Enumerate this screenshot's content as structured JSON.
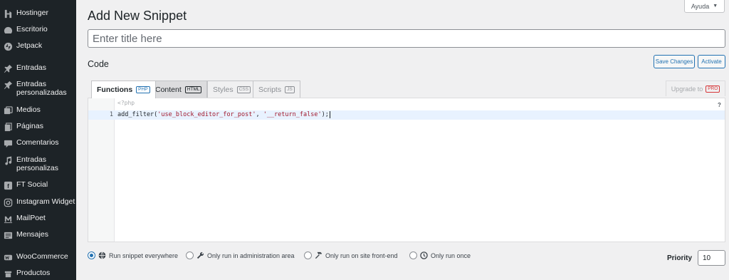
{
  "sidebar": {
    "items": [
      {
        "label": "Hostinger",
        "icon": "hostinger-icon"
      },
      {
        "label": "Escritorio",
        "icon": "dashboard-icon"
      },
      {
        "label": "Jetpack",
        "icon": "jetpack-icon"
      },
      {
        "label": "Entradas",
        "icon": "pin-icon"
      },
      {
        "label": "Entradas personalizadas",
        "icon": "pin-icon"
      },
      {
        "label": "Medios",
        "icon": "media-icon"
      },
      {
        "label": "Páginas",
        "icon": "pages-icon"
      },
      {
        "label": "Comentarios",
        "icon": "comments-icon"
      },
      {
        "label": "Entradas personalizas",
        "icon": "music-icon"
      },
      {
        "label": "FT Social",
        "icon": "social-icon"
      },
      {
        "label": "Instagram Widget",
        "icon": "instagram-icon"
      },
      {
        "label": "MailPoet",
        "icon": "mailpoet-icon"
      },
      {
        "label": "Mensajes",
        "icon": "messages-icon"
      },
      {
        "label": "WooCommerce",
        "icon": "woocommerce-icon"
      },
      {
        "label": "Productos",
        "icon": "products-icon"
      }
    ]
  },
  "header": {
    "title": "Add New Snippet",
    "help_label": "Ayuda"
  },
  "title_field": {
    "placeholder": "Enter title here",
    "value": ""
  },
  "code_section": {
    "label": "Code",
    "save_label": "Save Changes",
    "activate_label": "Activate"
  },
  "tabs": [
    {
      "label": "Functions",
      "badge": "PHP"
    },
    {
      "label": "Content",
      "badge": "HTML"
    },
    {
      "label": "Styles",
      "badge": "CSS"
    },
    {
      "label": "Scripts",
      "badge": "JS"
    }
  ],
  "upgrade": {
    "label": "Upgrade to",
    "badge": "PRO"
  },
  "editor": {
    "php_open": "<?php",
    "help_mark": "?",
    "line_number": "1",
    "code_fn": "add_filter(",
    "code_arg1": "'use_block_editor_for_post'",
    "code_sep": ", ",
    "code_arg2": "'__return_false'",
    "code_end": ");"
  },
  "scope": {
    "selected": "everywhere",
    "options": [
      {
        "label": "Run snippet everywhere",
        "icon": "globe-icon"
      },
      {
        "label": "Only run in administration area",
        "icon": "wrench-icon"
      },
      {
        "label": "Only run on site front-end",
        "icon": "hammer-icon"
      },
      {
        "label": "Only run once",
        "icon": "clock-icon"
      }
    ]
  },
  "priority": {
    "label": "Priority",
    "value": "10"
  },
  "colors": {
    "sidebar_bg": "#1d2327",
    "accent": "#2271b1",
    "page_bg": "#f0f0f1",
    "pro_badge": "#d63638"
  }
}
